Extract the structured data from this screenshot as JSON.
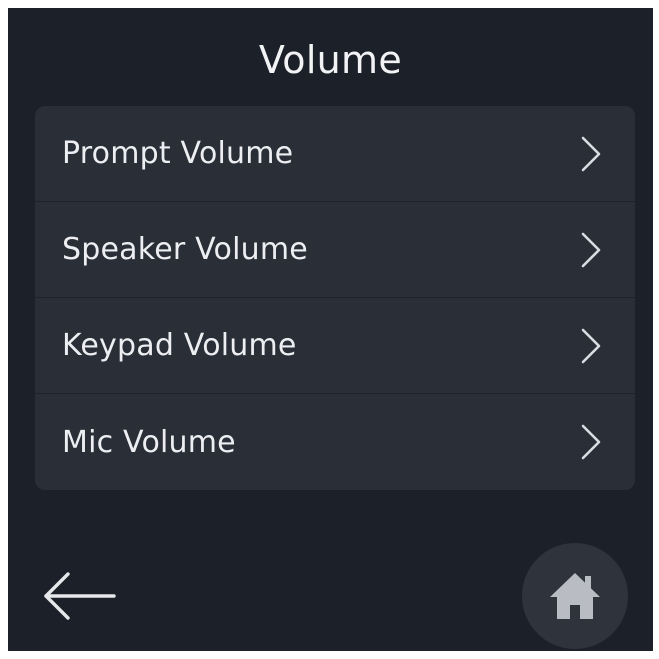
{
  "header": {
    "title": "Volume"
  },
  "menu": {
    "items": [
      {
        "label": "Prompt Volume"
      },
      {
        "label": "Speaker Volume"
      },
      {
        "label": "Keypad Volume"
      },
      {
        "label": "Mic Volume"
      }
    ]
  },
  "navigation": {
    "back_icon": "arrow-left-icon",
    "home_icon": "home-icon"
  },
  "colors": {
    "background": "#1c2029",
    "card": "#2a2e37",
    "text": "#eceef1",
    "icon": "#d9dce0"
  }
}
